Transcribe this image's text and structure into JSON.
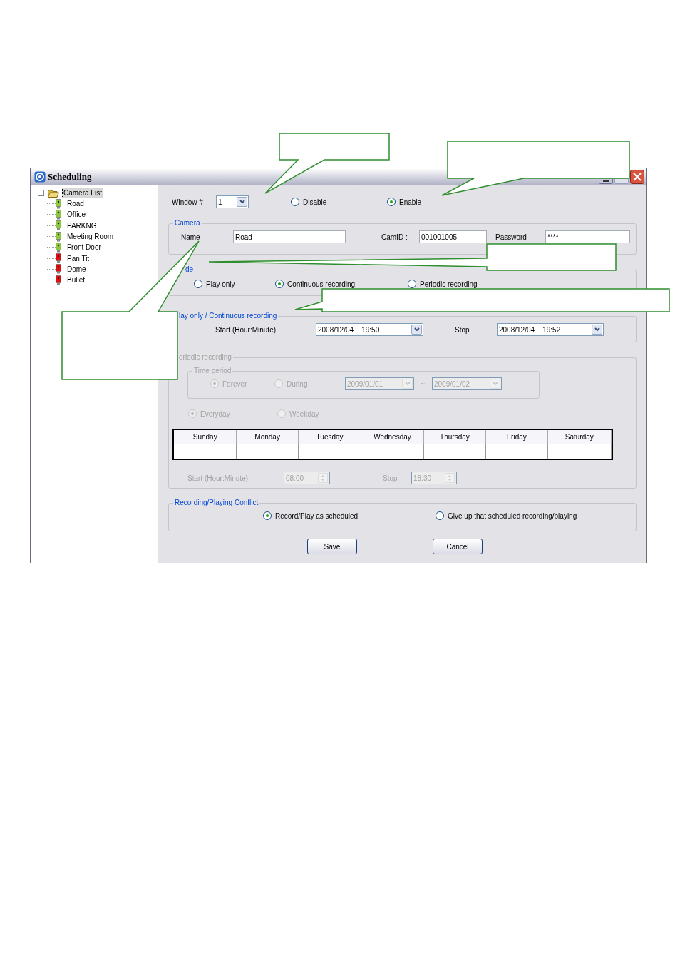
{
  "window": {
    "title": "Scheduling"
  },
  "tree": [
    {
      "label": "Camera List",
      "selected": true,
      "expanded": true,
      "children": [
        {
          "label": "Road",
          "selected": false,
          "color": "#8dc63f"
        },
        {
          "label": "Office",
          "selected": false,
          "color": "#8dc63f"
        },
        {
          "label": "PARKNG",
          "selected": false,
          "color": "#8dc63f"
        },
        {
          "label": "Meeting Room",
          "selected": false,
          "color": "#8dc63f"
        },
        {
          "label": "Front Door",
          "selected": false,
          "color": "#8dc63f"
        },
        {
          "label": "Pan Tit",
          "selected": false,
          "color": "#e01010"
        },
        {
          "label": "Dome",
          "selected": false,
          "color": "#e01010"
        },
        {
          "label": "Bullet",
          "selected": false,
          "color": "#e01010"
        }
      ]
    }
  ],
  "window_number": {
    "label": "Window #",
    "value": "1"
  },
  "state_options": [
    {
      "label": "Disable",
      "selected": false
    },
    {
      "label": "Enable",
      "selected": true
    }
  ],
  "camera": {
    "legend": "Camera",
    "fields": [
      {
        "label": "Name",
        "value": "Road"
      },
      {
        "label": "CamID :",
        "value": "001001005"
      },
      {
        "label": "Password",
        "value": "****"
      }
    ]
  },
  "mode": {
    "legend": "de",
    "options": [
      {
        "label": "Play only",
        "selected": false
      },
      {
        "label": "Continuous recording",
        "selected": true
      },
      {
        "label": "Periodic recording",
        "selected": false
      }
    ]
  },
  "play_continuous": {
    "legend": "lay only / Continuous recording",
    "start_label": "Start (Hour:Minute)",
    "start_value": "2008/12/04    19:50",
    "stop_label": "Stop",
    "stop_value": "2008/12/04    19:52"
  },
  "periodic": {
    "legend": "eriodic recording",
    "disabled": true,
    "time_period": {
      "legend": "Time period",
      "options": [
        {
          "label": "Forever",
          "selected": true
        },
        {
          "label": "During",
          "selected": false
        }
      ],
      "from": "2009/01/01",
      "separator": "~",
      "to": "2009/01/02"
    },
    "frequency": [
      {
        "label": "Everyday",
        "selected": true
      },
      {
        "label": "Weekday",
        "selected": false
      }
    ],
    "days": [
      "Sunday",
      "Monday",
      "Tuesday",
      "Wednesday",
      "Thursday",
      "Friday",
      "Saturday"
    ],
    "start_label": "Start (Hour:Minute)",
    "start_value": "08:00",
    "stop_label": "Stop",
    "stop_value": "18:30"
  },
  "conflict": {
    "legend": "Recording/Playing Conflict",
    "options": [
      {
        "label": "Record/Play as scheduled",
        "selected": true
      },
      {
        "label": "Give up that scheduled recording/playing",
        "selected": false
      }
    ]
  },
  "buttons": [
    "Save",
    "Cancel"
  ]
}
